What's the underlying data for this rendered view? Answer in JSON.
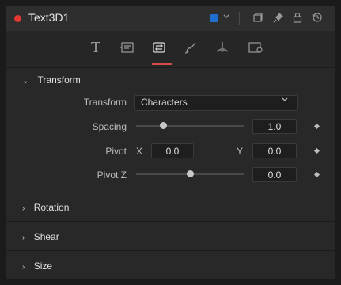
{
  "window": {
    "title": "Text3D1",
    "status_color": "#e53935",
    "swatch_color": "#1f6fd1",
    "header_icons": [
      "color-swatch",
      "chevron-down-icon",
      "clip-icon",
      "pin-icon",
      "lock-icon",
      "reset-icon"
    ]
  },
  "toolbar": {
    "active_tab": "transform",
    "tabs": [
      "text-icon",
      "layout-icon",
      "transform-icon",
      "shading-icon",
      "3d-axis-icon",
      "settings-icon"
    ]
  },
  "transform_section": {
    "header": "Transform",
    "transform_label": "Transform",
    "transform_value": "Characters",
    "spacing_label": "Spacing",
    "spacing_value": "1.0",
    "spacing_slider_level": 0.26,
    "pivot_label": "Pivot",
    "pivot_x_label": "X",
    "pivot_x_value": "0.0",
    "pivot_y_label": "Y",
    "pivot_y_value": "0.0",
    "pivot_z_label": "Pivot Z",
    "pivot_z_value": "0.0",
    "pivot_z_slider_level": 0.5
  },
  "sections": {
    "rotation": "Rotation",
    "shear": "Shear",
    "size": "Size"
  }
}
